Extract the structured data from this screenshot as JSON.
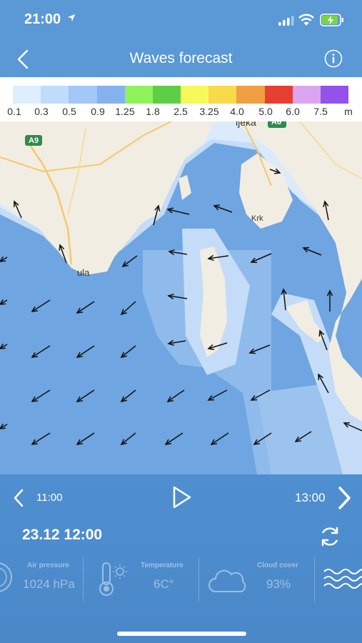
{
  "status": {
    "time": "21:00"
  },
  "nav": {
    "title": "Waves forecast"
  },
  "legend": {
    "colors": [
      "#dceeff",
      "#c0dcfb",
      "#a3c7f6",
      "#85b1ef",
      "#8ef25b",
      "#5ece45",
      "#f7f95a",
      "#f9da4b",
      "#efa043",
      "#e53f33",
      "#dca5f0",
      "#9352ea"
    ],
    "labels": [
      "0.1",
      "0.3",
      "0.5",
      "0.9",
      "1.25",
      "1.8",
      "2.5",
      "3.25",
      "4.0",
      "5.0",
      "6.0",
      "7.5",
      "m"
    ]
  },
  "map": {
    "place_labels": {
      "rijeka": "ijeka",
      "krk": "Krk",
      "pula": "ula",
      "road_a9": "A9",
      "road_a6": "A6"
    }
  },
  "timeline": {
    "prev_time": "11:00",
    "next_time": "13:00",
    "current": "23.12 12:00"
  },
  "stats": [
    {
      "label": "Air pressure",
      "value": "1024 hPa"
    },
    {
      "label": "Temperature",
      "value": "6C°"
    },
    {
      "label": "Cloud cover",
      "value": "93%"
    }
  ]
}
